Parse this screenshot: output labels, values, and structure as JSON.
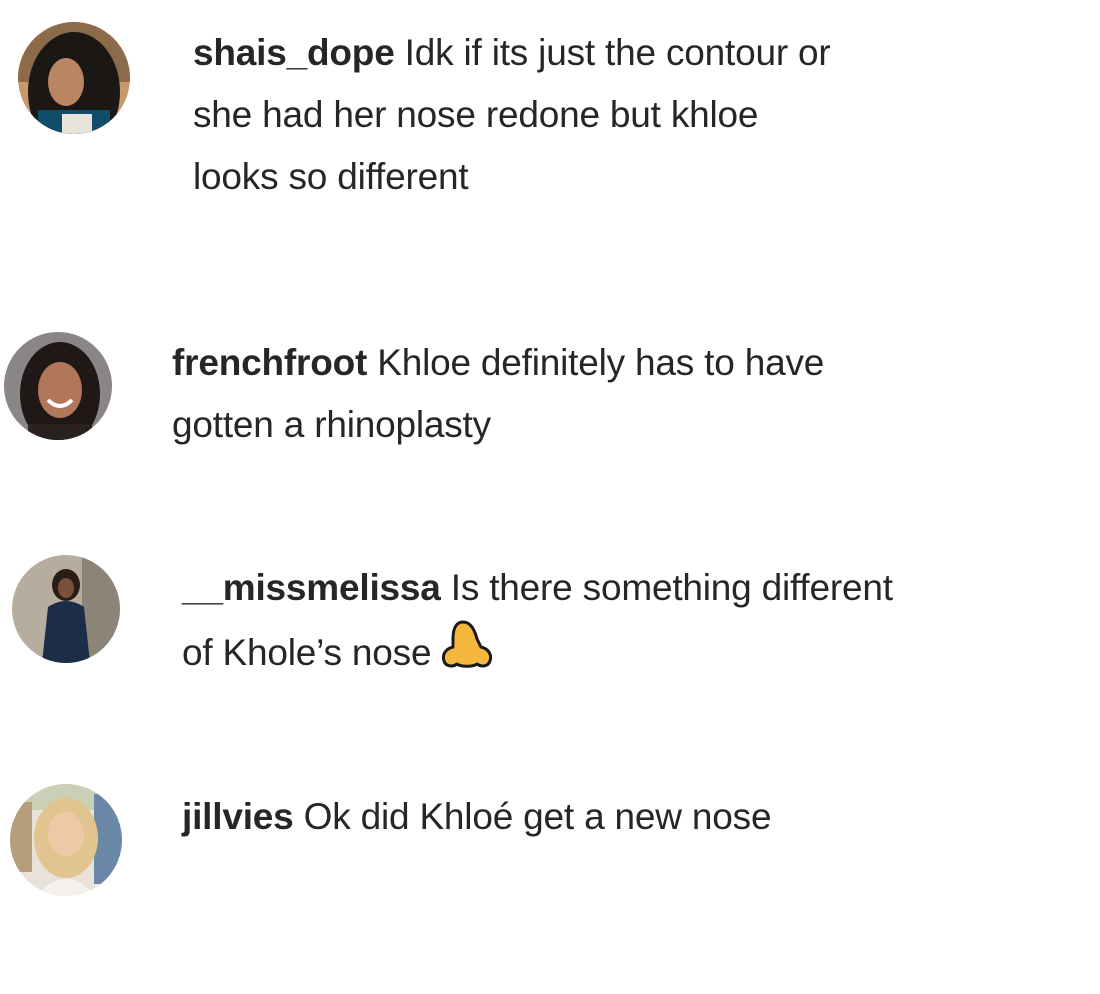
{
  "comments": [
    {
      "username": "shais_dope",
      "text": "Idk if its just the contour or she had her nose redone but khloe looks so different",
      "avatar_icon": "avatar-dark-hair"
    },
    {
      "username": "frenchfroot",
      "text": "Khloe definitely has to have gotten a rhinoplasty",
      "avatar_icon": "avatar-smiling-woman"
    },
    {
      "username": "__missmelissa",
      "text": "Is there something different of Khole’s nose",
      "emoji": "nose-emoji",
      "avatar_icon": "avatar-standing-woman"
    },
    {
      "username": "jillvies",
      "text": "Ok did Khloé get a new nose",
      "avatar_icon": "avatar-blonde-woman"
    }
  ],
  "colors": {
    "text": "#262626",
    "background": "#ffffff",
    "emoji": "#f5b83d"
  }
}
